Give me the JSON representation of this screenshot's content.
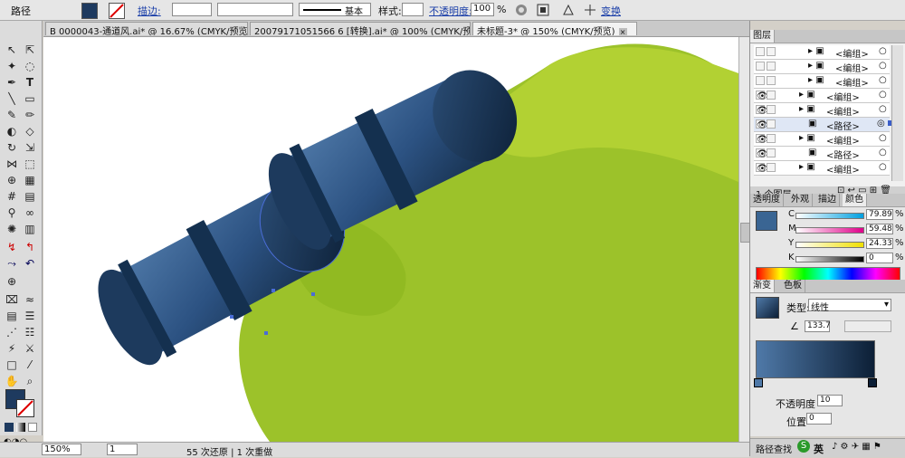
{
  "control_bar": {
    "object_type": "路径",
    "stroke_label": "描边:",
    "stroke_style": "基本",
    "style_label": "样式:",
    "opacity_label": "不透明度:",
    "opacity_value": "100",
    "opacity_unit": "%",
    "transform_label": "变换"
  },
  "tabs": [
    {
      "label": "B 0000043-通道风.ai* @ 16.67% (CMYK/预览)"
    },
    {
      "label": "20079171051566 6 [转换].ai* @ 100% (CMYK/预览)"
    },
    {
      "label": "未标题-3* @ 150% (CMYK/预览)"
    }
  ],
  "status": {
    "zoom": "150%",
    "page": "1",
    "history": "55 次还原 | 1 次重做"
  },
  "layers_panel": {
    "title": "图层",
    "rows": [
      {
        "label": "<编组>"
      },
      {
        "label": "<编组>"
      },
      {
        "label": "<编组>"
      },
      {
        "label": "<编组>"
      },
      {
        "label": "<编组>"
      },
      {
        "label": "<路径>"
      },
      {
        "label": "<编组>"
      },
      {
        "label": "<路径>"
      },
      {
        "label": "<编组>"
      }
    ],
    "footer": "1 个图层"
  },
  "color_panel": {
    "tabs": [
      "透明度",
      "外观",
      "描边",
      "颜色"
    ],
    "channels": [
      {
        "name": "C",
        "value": "79.89",
        "unit": "%"
      },
      {
        "name": "M",
        "value": "59.48",
        "unit": "%"
      },
      {
        "name": "Y",
        "value": "24.33",
        "unit": "%"
      },
      {
        "name": "K",
        "value": "0",
        "unit": "%"
      }
    ],
    "fill_color": "#3a6593"
  },
  "gradient_panel": {
    "tabs": [
      "渐变",
      "色板"
    ],
    "type_label": "类型:",
    "type_value": "线性",
    "angle_value": "133.7",
    "opacity_label": "不透明度",
    "opacity_value": "10",
    "location_label": "位置",
    "location_value": "0"
  },
  "bottom_right": {
    "pathfinder_label": "路径查找",
    "ime_label": "英"
  },
  "colors": {
    "accent": "#1a3ea8",
    "canvas_green": "#9cc22a",
    "cylinder_dark": "#14304f"
  }
}
